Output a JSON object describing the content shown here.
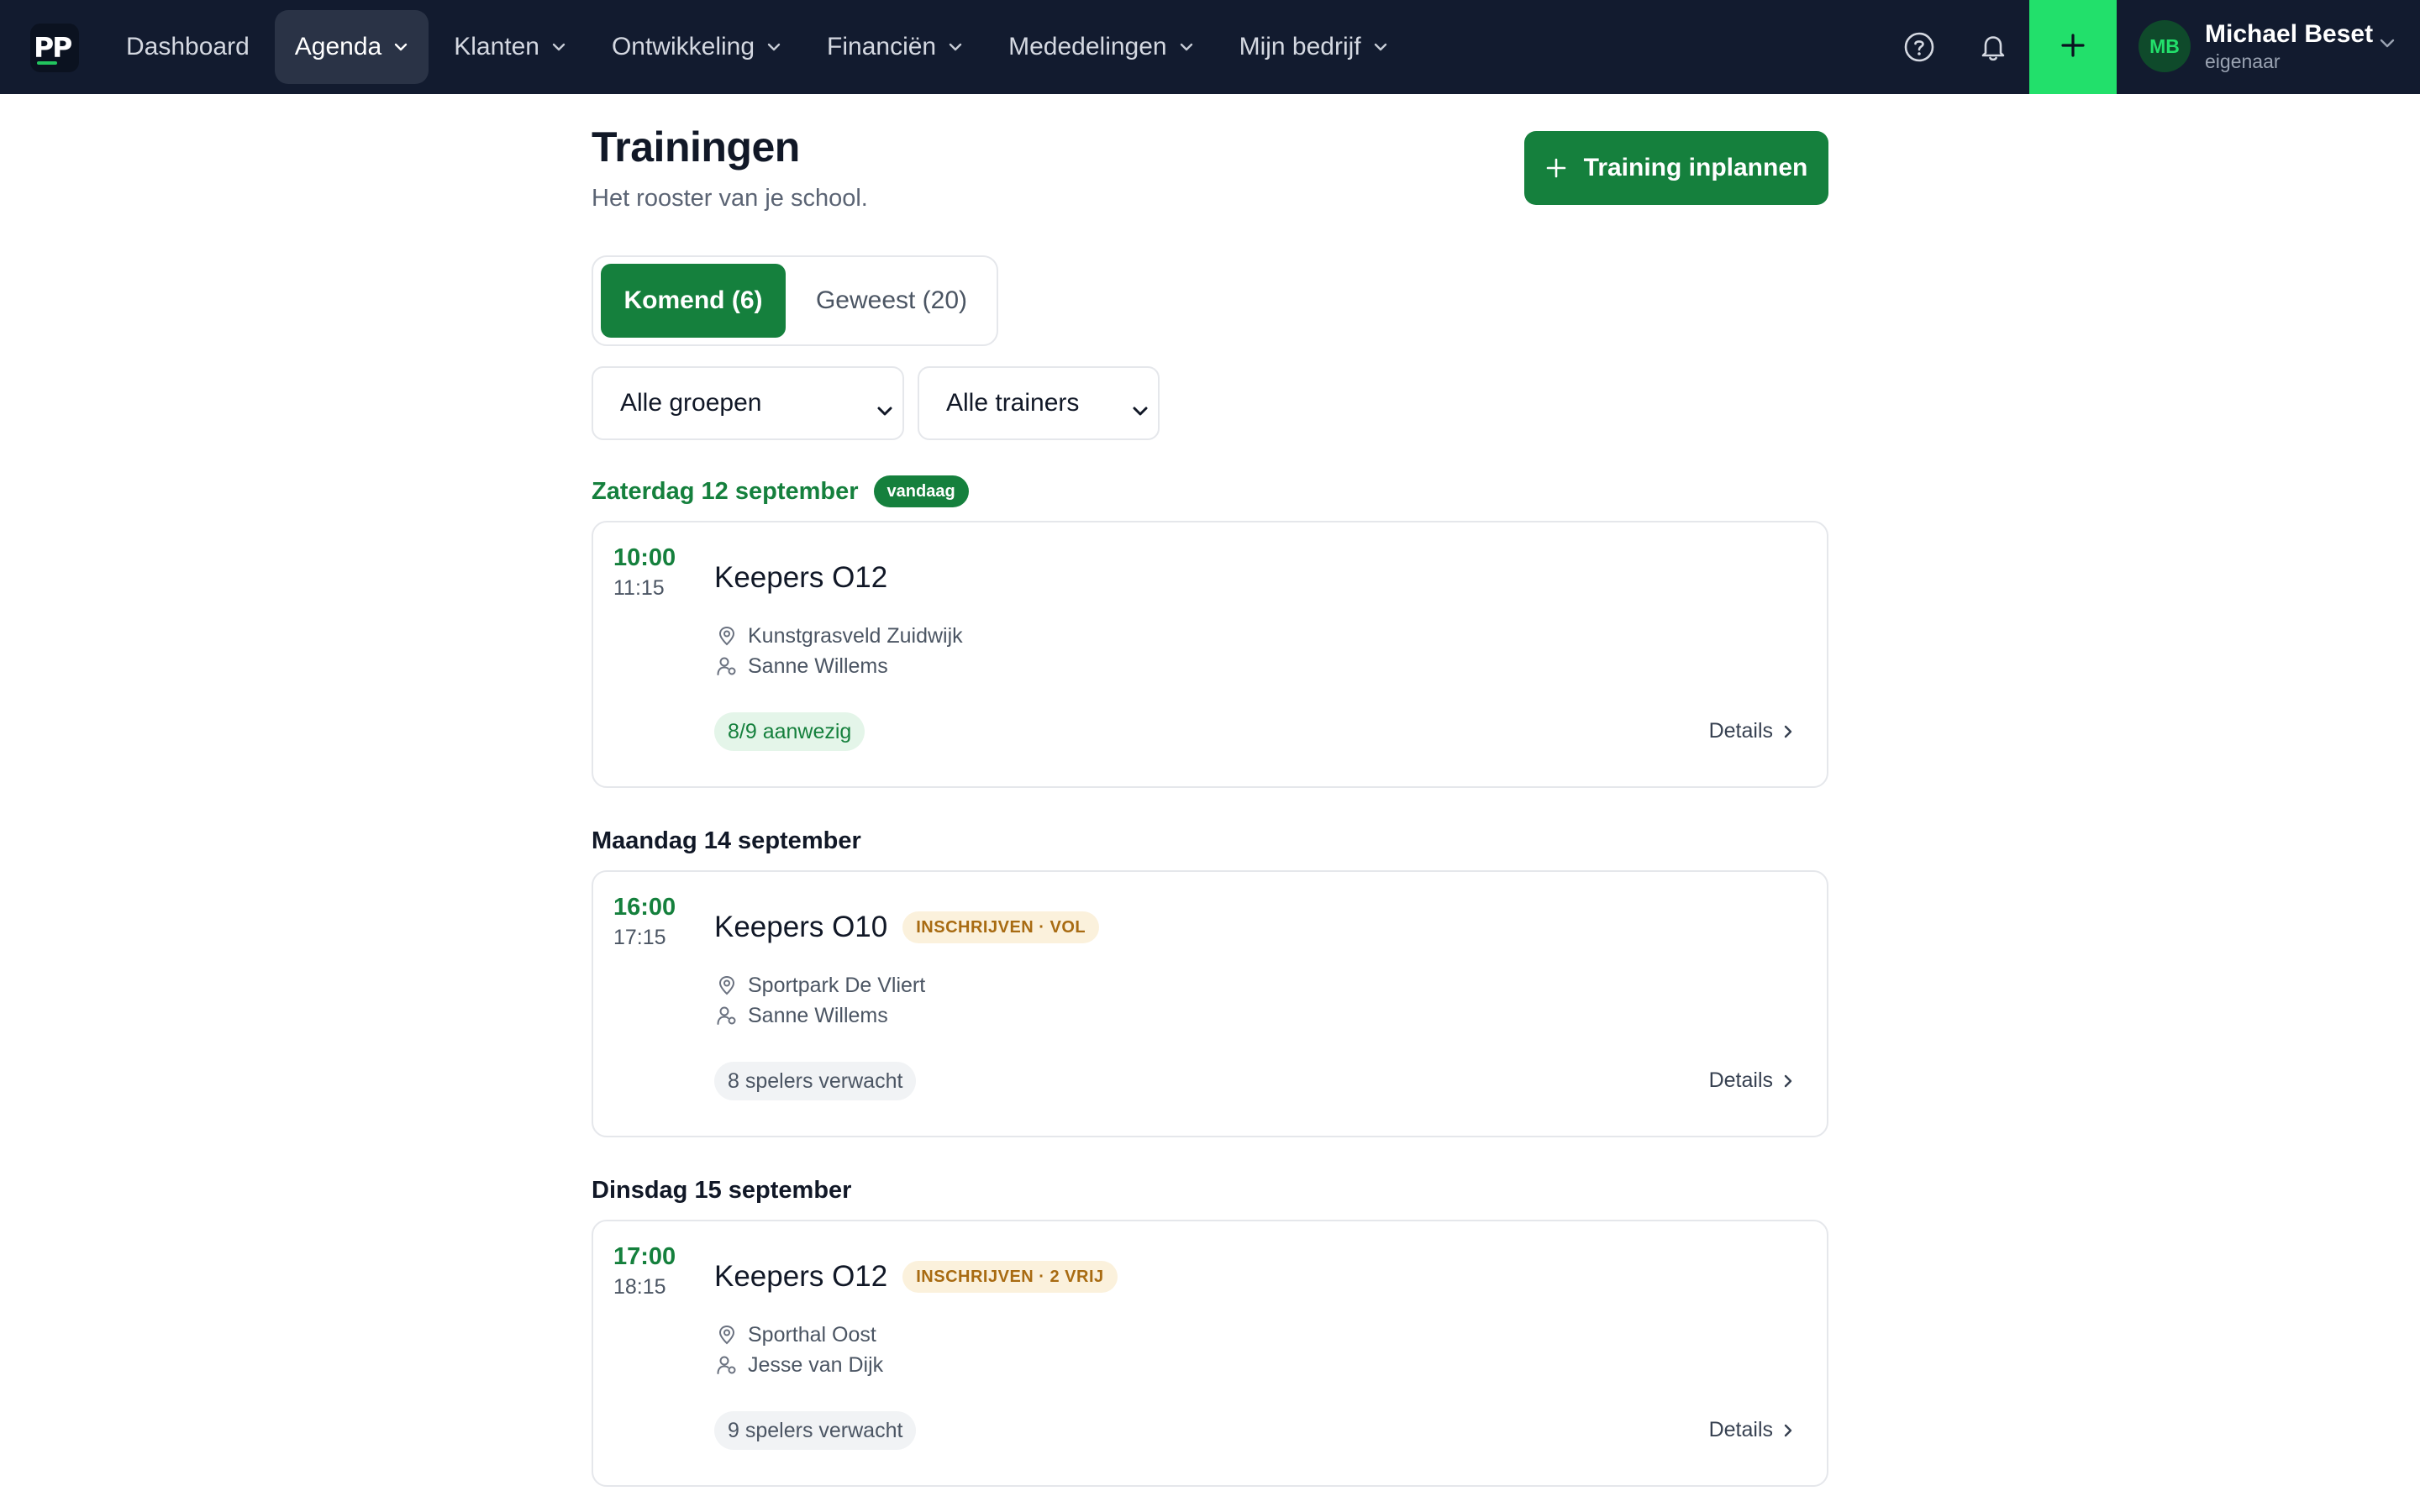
{
  "logo": {
    "text": "PP"
  },
  "nav": {
    "items": [
      {
        "label": "Dashboard",
        "dropdown": false,
        "active": false
      },
      {
        "label": "Agenda",
        "dropdown": true,
        "active": true
      },
      {
        "label": "Klanten",
        "dropdown": true,
        "active": false
      },
      {
        "label": "Ontwikkeling",
        "dropdown": true,
        "active": false
      },
      {
        "label": "Financiën",
        "dropdown": true,
        "active": false
      },
      {
        "label": "Mededelingen",
        "dropdown": true,
        "active": false
      },
      {
        "label": "Mijn bedrijf",
        "dropdown": true,
        "active": false
      }
    ]
  },
  "topbar": {
    "icons": [
      "help-icon",
      "bell-icon",
      "plus-icon"
    ]
  },
  "user": {
    "initials": "MB",
    "name": "Michael Beset",
    "role": "eigenaar"
  },
  "page": {
    "title": "Trainingen",
    "subtitle": "Het rooster van je school.",
    "primary_action": "Training inplannen"
  },
  "tabs": {
    "upcoming": "Komend (6)",
    "past": "Geweest (20)"
  },
  "filters": {
    "groups": "Alle groepen",
    "trainers": "Alle trainers"
  },
  "days": [
    {
      "label": "Zaterdag 12 september",
      "badge": "vandaag",
      "trainings": [
        {
          "start": "10:00",
          "end": "11:15",
          "title": "Keepers O12",
          "status": "",
          "location": "Kunstgrasveld Zuidwijk",
          "trainer": "Sanne Willems",
          "attendance": "8/9 aanwezig",
          "details": "Details"
        }
      ]
    },
    {
      "label": "Maandag 14 september",
      "badge": "",
      "trainings": [
        {
          "start": "16:00",
          "end": "17:15",
          "title": "Keepers O10",
          "status": "INSCHRIJVEN · VOL",
          "location": "Sportpark De Vliert",
          "trainer": "Sanne Willems",
          "attendance": "8 spelers verwacht",
          "details": "Details"
        }
      ]
    },
    {
      "label": "Dinsdag 15 september",
      "badge": "",
      "trainings": [
        {
          "start": "17:00",
          "end": "18:15",
          "title": "Keepers O12",
          "status": "INSCHRIJVEN · 2 VRIJ",
          "location": "Sporthal Oost",
          "trainer": "Jesse van Dijk",
          "attendance": "9 spelers verwacht",
          "details": "Details"
        }
      ]
    }
  ],
  "colors": {
    "nav_bg": "#121b2f",
    "brand_green": "#15803d",
    "accent_green": "#22e06b",
    "badge_amber_bg": "#fbf1dc",
    "badge_amber_text": "#a86b12"
  }
}
